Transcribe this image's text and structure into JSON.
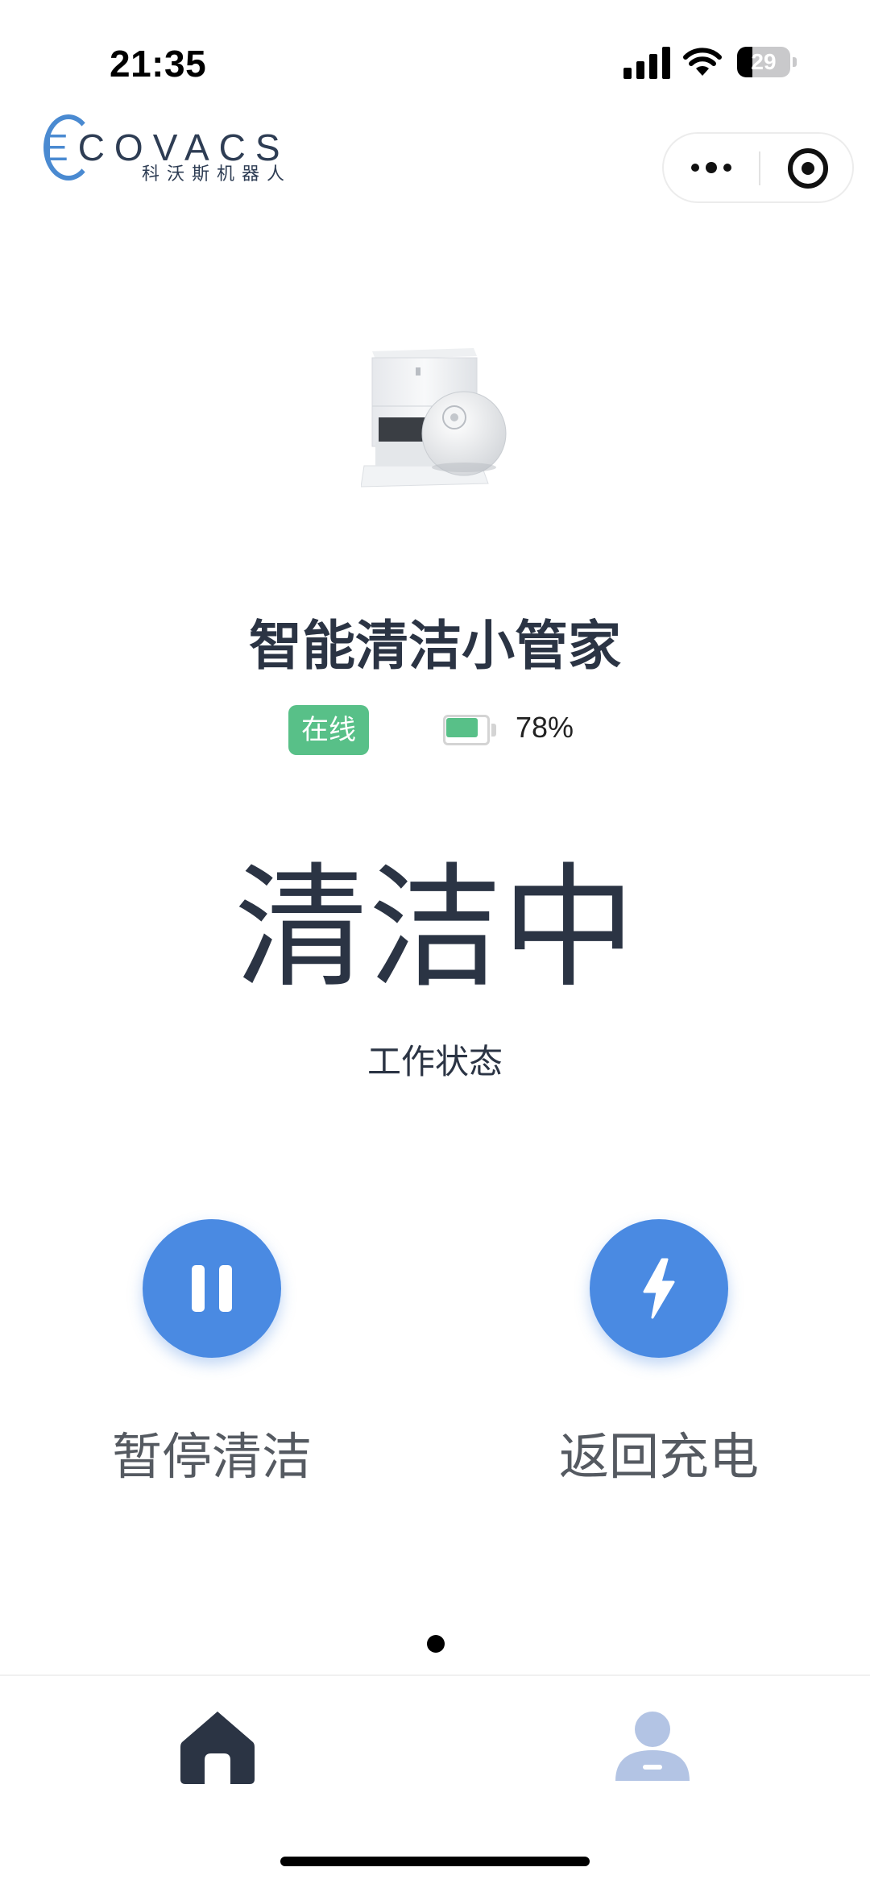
{
  "status_bar": {
    "time": "21:35",
    "battery_level": "29",
    "battery_fraction": 0.29,
    "icons": [
      "cellular-signal-icon",
      "wifi-icon",
      "battery-icon"
    ]
  },
  "header": {
    "brand_logo_text": "ECOVACS",
    "brand_logo_subtitle": "科沃斯机器人",
    "capsule": {
      "more_icon": "more-dots-icon",
      "close_icon": "target-close-icon"
    }
  },
  "device": {
    "name": "智能清洁小管家",
    "online_status": "在线",
    "battery_percent_label": "78%",
    "battery_fraction": 0.78,
    "work_status": "清洁中",
    "work_status_label": "工作状态"
  },
  "actions": [
    {
      "label": "暂停清洁",
      "icon": "pause-icon"
    },
    {
      "label": "返回充电",
      "icon": "lightning-icon"
    }
  ],
  "pager": {
    "pages": 1,
    "active": 1
  },
  "tabbar": {
    "items": [
      {
        "icon": "home-icon",
        "active": true
      },
      {
        "icon": "user-icon",
        "active": false
      }
    ]
  },
  "colors": {
    "accent": "#4a8ae2",
    "online_green": "#58c088",
    "text_dark": "#2b3444",
    "inactive_tab": "#b3c4e4"
  }
}
